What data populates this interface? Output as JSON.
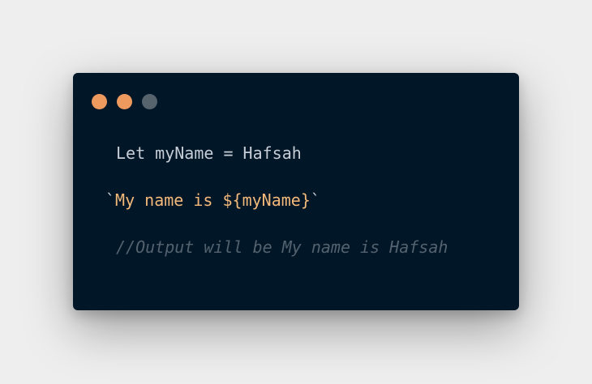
{
  "window": {
    "controls": [
      {
        "name": "window-dot-close",
        "color": "#ee9a5f"
      },
      {
        "name": "window-dot-minimize",
        "color": "#ee9a5f"
      },
      {
        "name": "window-dot-maximize",
        "color": "#56636d"
      }
    ]
  },
  "code": {
    "line1": "Let myName = Hafsah",
    "line2": {
      "open_backtick": "`",
      "template": "My name is ${myName}",
      "close_backtick": "`"
    },
    "line3": "//Output will be My name is Hafsah"
  },
  "colors": {
    "background": "#eeeeee",
    "editor_background": "#011627",
    "text": "#c7cdd6",
    "string": "#f3b97a",
    "comment": "#54626f"
  }
}
